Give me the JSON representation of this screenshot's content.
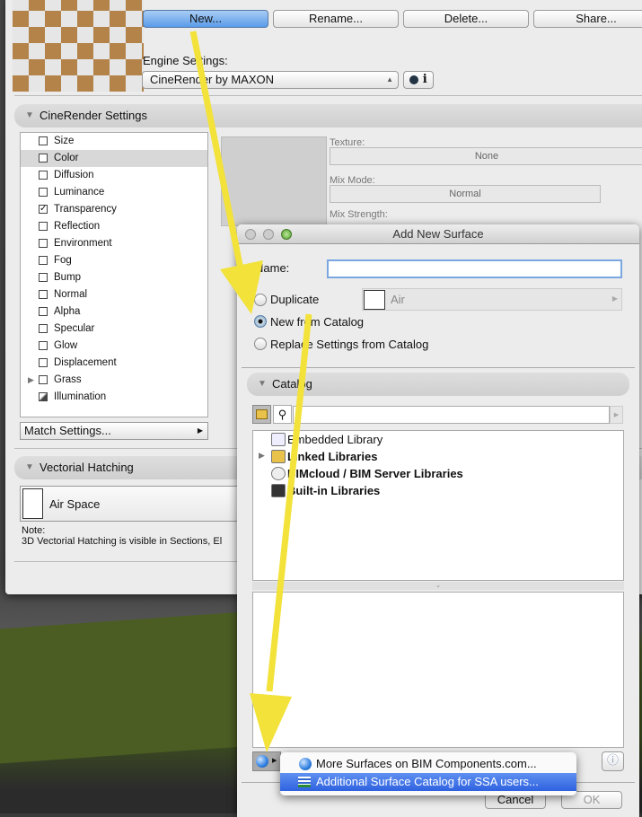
{
  "main_window": {
    "buttons": {
      "new": "New...",
      "rename": "Rename...",
      "delete": "Delete...",
      "share": "Share..."
    },
    "engine_settings_label": "Engine Settings:",
    "engine_value": "CineRender by MAXON",
    "info_label": "i",
    "cinerender_section": "CineRender Settings",
    "channels": [
      {
        "label": "Size",
        "checked": false,
        "icon": "size-icon"
      },
      {
        "label": "Color",
        "checked": false,
        "selected": true
      },
      {
        "label": "Diffusion",
        "checked": false
      },
      {
        "label": "Luminance",
        "checked": false
      },
      {
        "label": "Transparency",
        "checked": true
      },
      {
        "label": "Reflection",
        "checked": false
      },
      {
        "label": "Environment",
        "checked": false
      },
      {
        "label": "Fog",
        "checked": false
      },
      {
        "label": "Bump",
        "checked": false
      },
      {
        "label": "Normal",
        "checked": false
      },
      {
        "label": "Alpha",
        "checked": false
      },
      {
        "label": "Specular",
        "checked": false
      },
      {
        "label": "Glow",
        "checked": false
      },
      {
        "label": "Displacement",
        "checked": false
      },
      {
        "label": "Grass",
        "checked": false,
        "expandable": true
      },
      {
        "label": "Illumination",
        "checked": false,
        "icon": "illumination-icon"
      }
    ],
    "check_mark": "✓",
    "match_settings": "Match Settings...",
    "texture_label": "Texture:",
    "texture_value": "None",
    "mix_mode_label": "Mix Mode:",
    "mix_mode_value": "Normal",
    "mix_strength_label": "Mix Strength:",
    "vectorial_section": "Vectorial Hatching",
    "hatch_value": "Air Space",
    "note_label": "Note:",
    "note_text": "3D Vectorial Hatching is visible in Sections, El"
  },
  "dialog": {
    "title": "Add New Surface",
    "name_label": "Name:",
    "name_value": "",
    "options": [
      {
        "label": "Duplicate",
        "selected": false
      },
      {
        "label": "New from Catalog",
        "selected": true
      },
      {
        "label": "Replace Settings from Catalog",
        "selected": false
      }
    ],
    "duplicate_source": "Air",
    "catalog_section": "Catalog",
    "search_value": "",
    "libraries": [
      {
        "label": "Embedded Library",
        "bold": false
      },
      {
        "label": "Linked Libraries",
        "bold": true,
        "expandable": true
      },
      {
        "label": "BIMcloud / BIM Server Libraries",
        "bold": true
      },
      {
        "label": "Built-in Libraries",
        "bold": true
      }
    ],
    "menu_items": [
      {
        "label": "More Surfaces on BIM Components.com...",
        "highlighted": false
      },
      {
        "label": "Additional Surface Catalog for SSA users...",
        "highlighted": true
      }
    ],
    "cancel": "Cancel",
    "ok": "OK"
  },
  "colors": {
    "annotation_arrow": "#f2e23a",
    "highlight": "#3a6ee6",
    "focus": "#7aa7e0"
  }
}
